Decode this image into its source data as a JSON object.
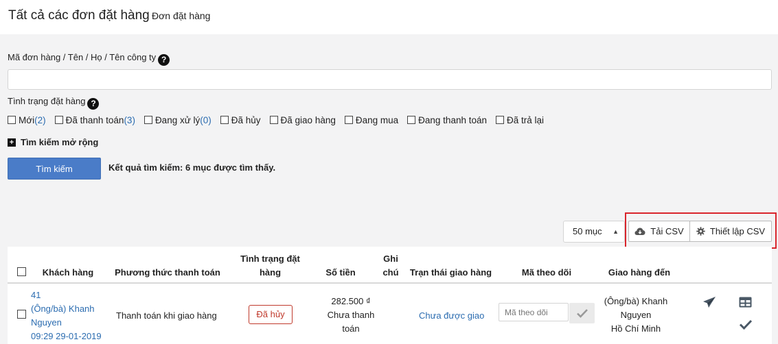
{
  "header": {
    "title": "Tất cả các đơn đặt hàng",
    "subtitle": "Đơn đặt hàng"
  },
  "search": {
    "label": "Mã đơn hàng / Tên / Họ / Tên công ty",
    "value": "",
    "status_label": "Tình trạng đặt hàng",
    "statuses": [
      {
        "label": "Mới",
        "count": "(2)"
      },
      {
        "label": "Đã thanh toán",
        "count": "(3)"
      },
      {
        "label": "Đang xử lý",
        "count": "(0)"
      },
      {
        "label": "Đã hủy",
        "count": ""
      },
      {
        "label": "Đã giao hàng",
        "count": ""
      },
      {
        "label": "Đang mua",
        "count": ""
      },
      {
        "label": "Đang thanh toán",
        "count": ""
      },
      {
        "label": "Đã trả lại",
        "count": ""
      }
    ],
    "advanced_label": "Tìm kiếm mở rộng",
    "button_label": "Tìm kiếm",
    "result_text": "Kết quả tìm kiếm: 6 mục được tìm thấy."
  },
  "toolbar": {
    "per_page": "50 mục",
    "download_csv": "Tải CSV",
    "csv_settings": "Thiết lập CSV"
  },
  "table": {
    "headers": {
      "customer": "Khách hàng",
      "payment": "Phương thức thanh toán",
      "status_l1": "Tình trạng đặt",
      "status_l2": "hàng",
      "amount": "Số tiền",
      "note_l1": "Ghi",
      "note_l2": "chú",
      "delivery": "Trạn thái giao hàng",
      "tracking": "Mã theo dõi",
      "ship_to": "Giao hàng đến"
    },
    "row": {
      "order_id": "41",
      "customer_l1": "(Ông/bà) Khanh",
      "customer_l2": "Nguyen",
      "datetime": "09:29 29-01-2019",
      "payment": "Thanh toán khi giao hàng",
      "status": "Đã hủy",
      "amount": "282.500 ₫",
      "amount_note_l1": "Chưa thanh",
      "amount_note_l2": "toán",
      "delivery": "Chưa được giao",
      "tracking_placeholder": "Mã theo dõi",
      "ship_name_l1": "(Ông/bà) Khanh",
      "ship_name_l2": "Nguyen",
      "ship_city": "Hồ Chí Minh"
    }
  },
  "colors": {
    "accent": "#4a7cc8",
    "link": "#2b6cb0",
    "danger": "#c0392b",
    "highlight": "#d9242b"
  }
}
